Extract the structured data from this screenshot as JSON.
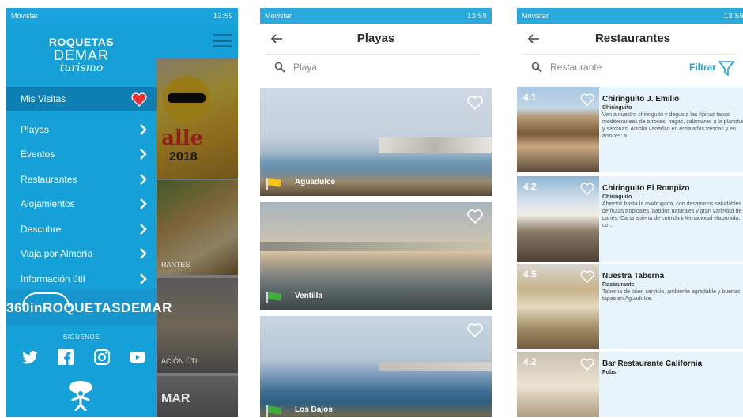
{
  "status": {
    "carrier": "Movistar",
    "time": "13:59"
  },
  "screen1": {
    "logo": {
      "line1": "ROQUETAS",
      "line2": "DEMAR",
      "line3": "turismo"
    },
    "header_item": "Mis Visitas",
    "menu": [
      "Playas",
      "Eventos",
      "Restaurantes",
      "Alojamientos",
      "Descubre",
      "Viaja por Almería",
      "Información útil"
    ],
    "brand360": "360inROQUETASDEMAR",
    "follow_label": "SIGUENOS",
    "social_icons": [
      "twitter-icon",
      "facebook-icon",
      "instagram-icon",
      "youtube-icon"
    ],
    "bg_labels": {
      "tile2": "RANTES",
      "tile3": "ACIÓN ÚTIL",
      "tile4": "MAR",
      "tile1_text": "alle",
      "tile1_year": "2018"
    }
  },
  "screen2": {
    "title": "Playas",
    "search_placeholder": "Playa",
    "beaches": [
      {
        "name": "Aguadulce",
        "flag_color": "#f5c518"
      },
      {
        "name": "Ventilla",
        "flag_color": "#3fae3a"
      },
      {
        "name": "Los Bajos",
        "flag_color": "#3fae3a"
      }
    ]
  },
  "screen3": {
    "title": "Restaurantes",
    "search_placeholder": "Restaurante",
    "filter_label": "Filtrar",
    "restaurants": [
      {
        "rating": "4.1",
        "name": "Chiringuito J. Emilio",
        "type": "Chiringuito",
        "desc": "Ven a nuestro chiringuito y degusta las típicas tapas mediterráneas de arroces, migas, calamares a la plancha y sardinas. Amplia variedad en ensaladas frescas y en arroces: a..."
      },
      {
        "rating": "4.2",
        "name": "Chiringuito El Rompizo",
        "type": "Chiringuito",
        "desc": "Abiertos hasta la madrugada, con desayunos saludables de frutas tropicales, batidos naturales y gran variedad de panes. Carta abierta de comida internacional elaborada: co..."
      },
      {
        "rating": "4.5",
        "name": "Nuestra Taberna",
        "type": "Restaurante",
        "desc": "Taberna de buen servicio, ambiente agradable y buenas tapas en Aguadulce."
      },
      {
        "rating": "4.2",
        "name": "Bar Restaurante California",
        "type": "Pubs",
        "desc": ""
      }
    ]
  },
  "colors": {
    "primary": "#16a0d8",
    "dark": "#0f7eb2",
    "heart": "#e8333b"
  }
}
